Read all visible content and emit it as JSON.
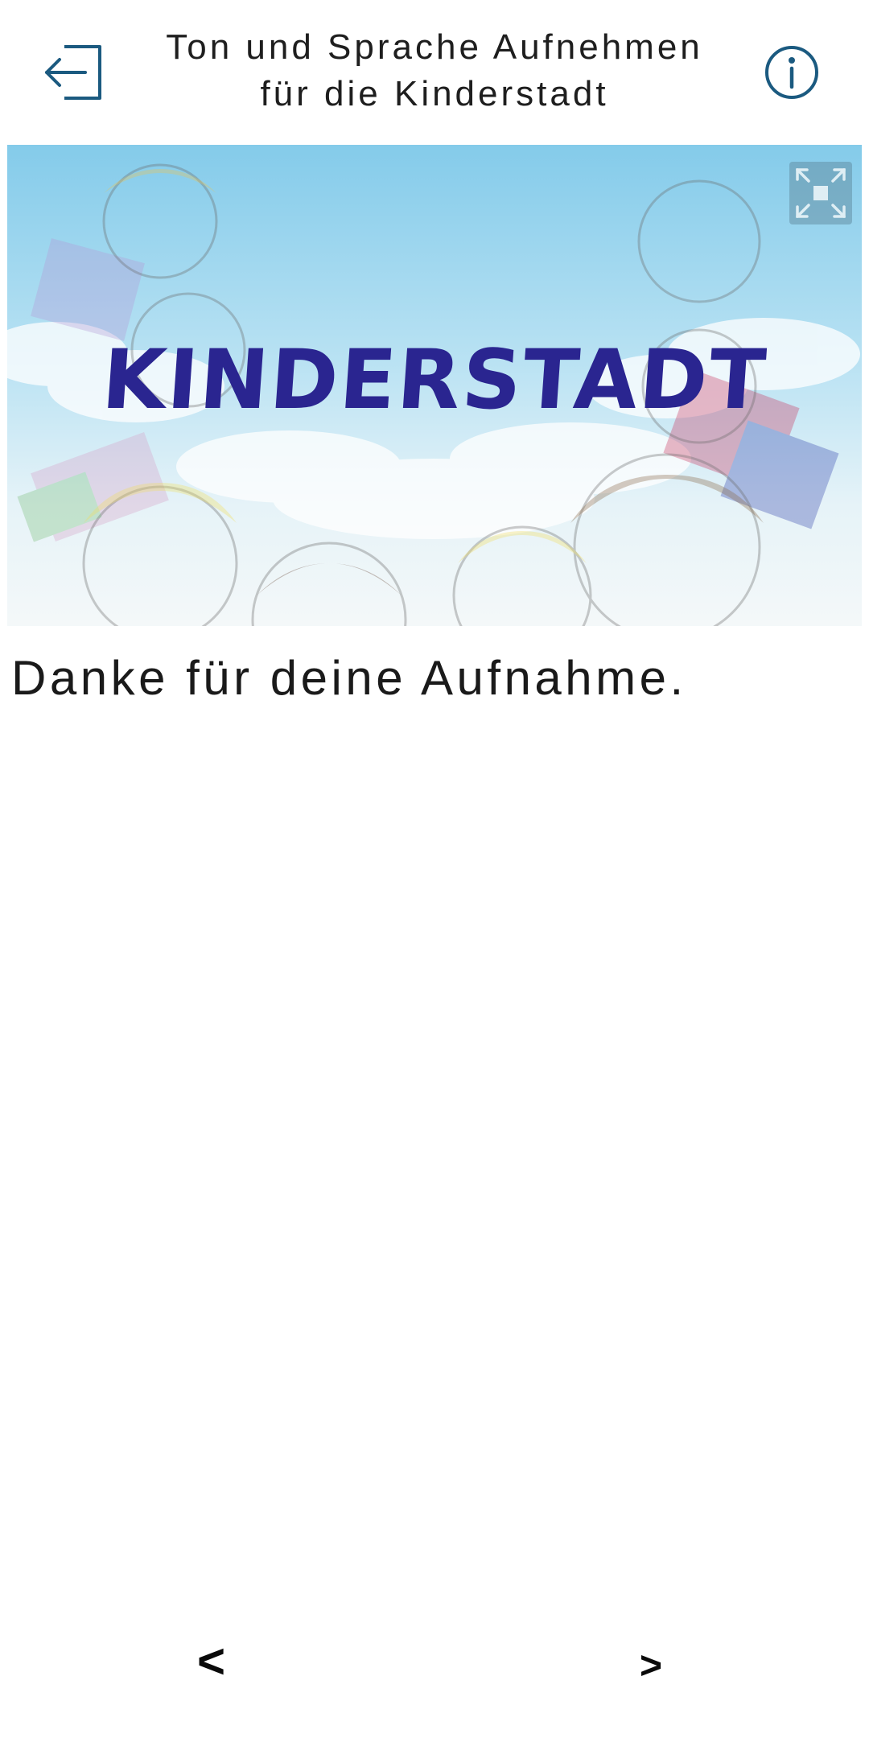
{
  "header": {
    "title_line1": "Ton und Sprache Aufnehmen",
    "title_line2": "für die Kinderstadt",
    "exit_icon": "exit-icon",
    "info_icon": "info-icon"
  },
  "banner": {
    "title": "KINDERSTADT",
    "fullscreen_icon": "fullscreen-icon"
  },
  "main": {
    "message": "Danke für deine Aufnahme."
  },
  "nav": {
    "prev_label": "<",
    "next_label": ">"
  },
  "colors": {
    "accent": "#1b5a80",
    "banner_title": "#2a2590",
    "sky": "#8fd0ec"
  }
}
